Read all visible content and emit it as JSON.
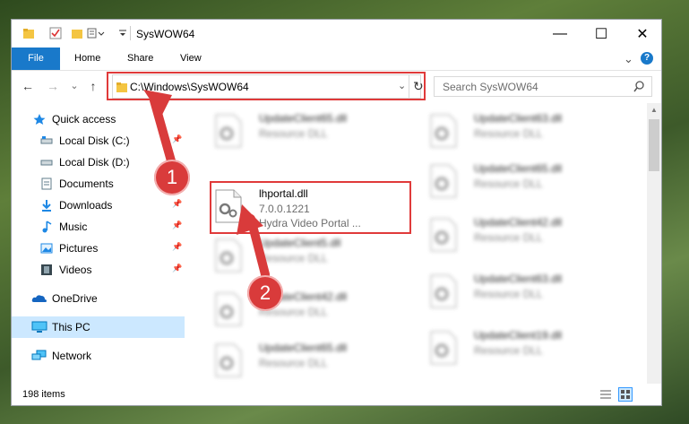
{
  "window": {
    "title": "SysWOW64",
    "controls": {
      "minimize": "—",
      "maximize": "☐",
      "close": "✕"
    },
    "help": "?"
  },
  "ribbon": {
    "tabs": [
      "File",
      "Home",
      "Share",
      "View"
    ],
    "chevron": "⌄"
  },
  "navigation": {
    "back": "←",
    "forward": "→",
    "recent": "⌄",
    "up": "↑",
    "address_path": "C:\\Windows\\SysWOW64",
    "address_dropdown": "⌄",
    "refresh": "↻"
  },
  "search": {
    "placeholder": "Search SysWOW64",
    "icon": "search-icon"
  },
  "sidebar": {
    "quick_access": "Quick access",
    "items": [
      {
        "label": "Local Disk (C:)",
        "icon": "drive-icon",
        "pinned": true
      },
      {
        "label": "Local Disk (D:)",
        "icon": "drive-icon",
        "pinned": false
      },
      {
        "label": "Documents",
        "icon": "documents-icon",
        "pinned": true
      },
      {
        "label": "Downloads",
        "icon": "downloads-icon",
        "pinned": true
      },
      {
        "label": "Music",
        "icon": "music-icon",
        "pinned": true
      },
      {
        "label": "Pictures",
        "icon": "pictures-icon",
        "pinned": true
      },
      {
        "label": "Videos",
        "icon": "videos-icon",
        "pinned": true
      }
    ],
    "onedrive": "OneDrive",
    "this_pc": "This PC",
    "network": "Network",
    "pin_glyph": "📌"
  },
  "files": {
    "left_column": [
      {
        "name": "UpdateClient65.dll",
        "type": "Resource DLL"
      },
      {
        "name": "lhportal.dll",
        "version": "7.0.0.1221",
        "description": "Hydra Video Portal ..."
      },
      {
        "name": "UpdateClient5.dll",
        "type": "Resource DLL"
      },
      {
        "name": "UpdateClient42.dll",
        "type": "Resource DLL"
      },
      {
        "name": "UpdateClient65.dll",
        "type": "Resource DLL"
      }
    ],
    "right_column": [
      {
        "name": "UpdateClient63.dll",
        "type": "Resource DLL"
      },
      {
        "name": "UpdateClient65.dll",
        "type": "Resource DLL"
      },
      {
        "name": "UpdateClient42.dll",
        "type": "Resource DLL"
      },
      {
        "name": "UpdateClient63.dll",
        "type": "Resource DLL"
      },
      {
        "name": "UpdateClient19.dll",
        "type": "Resource DLL"
      }
    ]
  },
  "status": {
    "item_count": "198 items"
  },
  "annotations": {
    "step1": "1",
    "step2": "2",
    "highlight_color": "#e03a3a",
    "arrow_color": "#d93b3b"
  },
  "colors": {
    "accent": "#1979ca",
    "selected": "#cce8ff"
  }
}
